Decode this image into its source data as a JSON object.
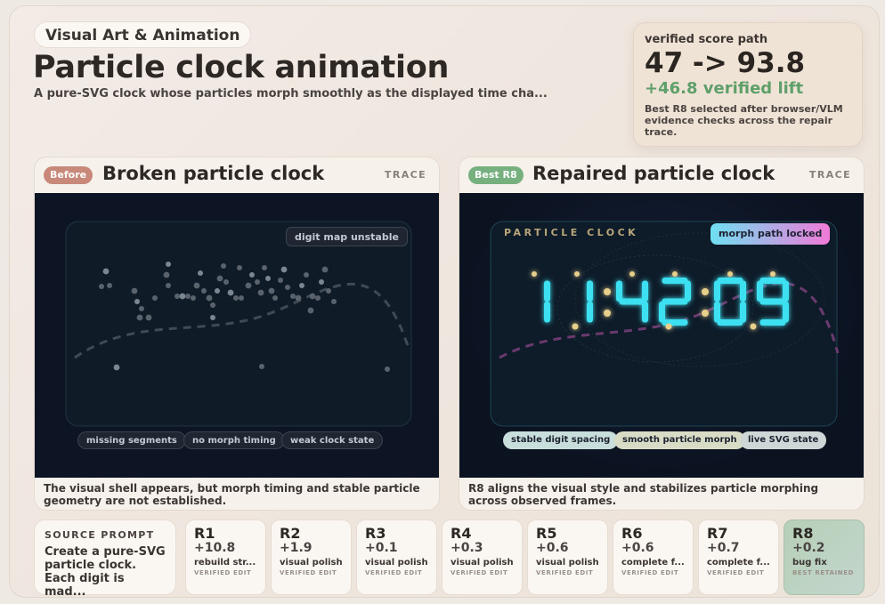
{
  "header": {
    "category": "Visual Art & Animation",
    "title": "Particle clock animation",
    "subtitle": "A pure-SVG clock whose particles morph smoothly as the displayed time cha..."
  },
  "score": {
    "label": "verified score path",
    "path": "47 -> 93.8",
    "lift": "+46.8 verified lift",
    "note": "Best R8 selected after browser/VLM evidence checks across the repair trace."
  },
  "before": {
    "badge": "Before",
    "title": "Broken particle clock",
    "trace": "TRACE",
    "status_chip": "digit map unstable",
    "chips": [
      "missing segments",
      "no morph timing",
      "weak clock state"
    ],
    "caption": "The visual shell appears, but morph timing and stable particle geometry are not established."
  },
  "after": {
    "badge": "Best R8",
    "title": "Repaired particle clock",
    "trace": "TRACE",
    "clock_label": "PARTICLE CLOCK",
    "status_chip": "morph path locked",
    "time": "11:42:09",
    "chips": [
      "stable digit spacing",
      "smooth particle morph",
      "live SVG state"
    ],
    "caption": "R8 aligns the visual style and stabilizes particle morphing across observed frames."
  },
  "prompt": {
    "heading": "SOURCE PROMPT",
    "text": "Create a pure-SVG particle clock. Each digit is mad..."
  },
  "rounds": [
    {
      "id": "R1",
      "delta": "+10.8",
      "desc": "rebuild str...",
      "status": "VERIFIED EDIT"
    },
    {
      "id": "R2",
      "delta": "+1.9",
      "desc": "visual polish",
      "status": "VERIFIED EDIT"
    },
    {
      "id": "R3",
      "delta": "+0.1",
      "desc": "visual polish",
      "status": "VERIFIED EDIT"
    },
    {
      "id": "R4",
      "delta": "+0.3",
      "desc": "visual polish",
      "status": "VERIFIED EDIT"
    },
    {
      "id": "R5",
      "delta": "+0.6",
      "desc": "visual polish",
      "status": "VERIFIED EDIT"
    },
    {
      "id": "R6",
      "delta": "+0.6",
      "desc": "complete f...",
      "status": "VERIFIED EDIT"
    },
    {
      "id": "R7",
      "delta": "+0.7",
      "desc": "complete f...",
      "status": "VERIFIED EDIT"
    },
    {
      "id": "R8",
      "delta": "+0.2",
      "desc": "bug fix",
      "status": "BEST RETAINED"
    }
  ],
  "colors": {
    "lift_green": "#5f9f6a",
    "before_badge": "#c9897a",
    "best_badge": "#77b07f",
    "digit_cyan": "#3ee0f0",
    "particle_gold": "#e6cf8a"
  }
}
